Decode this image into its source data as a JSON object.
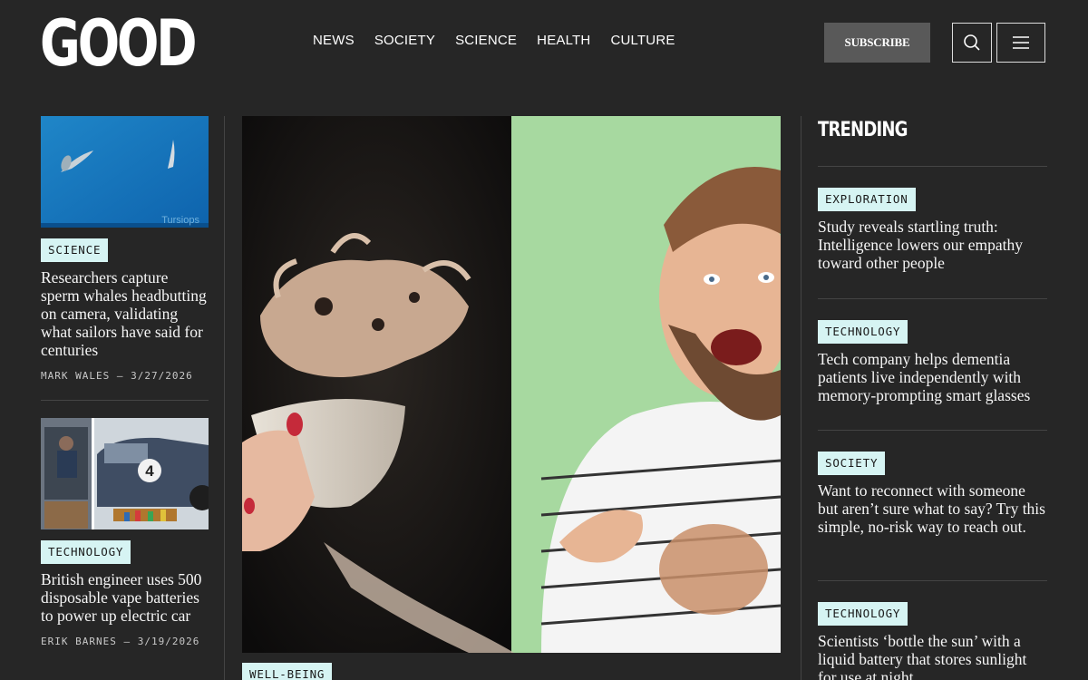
{
  "brand": {
    "logo": "GOOD"
  },
  "nav": {
    "items": [
      "NEWS",
      "SOCIETY",
      "SCIENCE",
      "HEALTH",
      "CULTURE"
    ]
  },
  "header": {
    "subscribe_label": "SUBSCRIBE"
  },
  "left_stories": [
    {
      "tag": "SCIENCE",
      "title": "Researchers capture sperm whales headbutting on camera, validating what sailors have said for centuries",
      "byline": "MARK WALES – 3/27/2026",
      "image_credit": "Tursiops"
    },
    {
      "tag": "TECHNOLOGY",
      "title": "British engineer uses 500 disposable vape batteries to power up electric car",
      "byline": "ERIK BARNES – 3/19/2026",
      "image_badge": "4"
    }
  ],
  "hero": {
    "tag": "WELL-BEING"
  },
  "trending": {
    "title": "TRENDING",
    "items": [
      {
        "tag": "EXPLORATION",
        "title": "Study reveals startling truth: Intelligence lowers our empathy toward other people"
      },
      {
        "tag": "TECHNOLOGY",
        "title": "Tech company helps dementia patients live independently with memory-prompting smart glasses"
      },
      {
        "tag": "SOCIETY",
        "title": "Want to reconnect with someone but aren’t sure what to say? Try this simple, no-risk way to reach out."
      },
      {
        "tag": "TECHNOLOGY",
        "title": "Scientists ‘bottle the sun’ with a liquid battery that stores sunlight for use at night"
      }
    ]
  },
  "colors": {
    "background": "#262626",
    "tag_bg": "#d6f4f3",
    "subscribe_bg": "#595959"
  }
}
